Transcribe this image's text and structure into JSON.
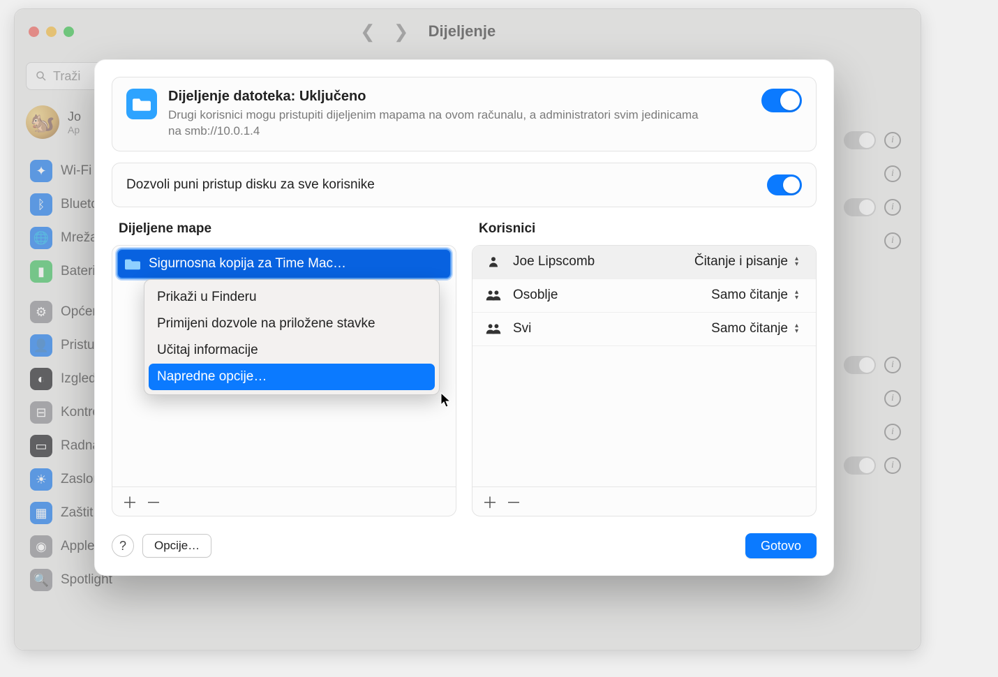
{
  "window": {
    "title": "Dijeljenje",
    "search_placeholder": "Traži"
  },
  "user": {
    "name": "Jo",
    "sub": "Ap"
  },
  "sidebar": {
    "items": [
      {
        "label": "Wi-Fi",
        "color": "#0b7aff"
      },
      {
        "label": "Blueto",
        "color": "#0b7aff"
      },
      {
        "label": "Mreža",
        "color": "#0b7aff"
      },
      {
        "label": "Baterij",
        "color": "#34c759"
      },
      {
        "label": "Općen",
        "color": "#8e8e93"
      },
      {
        "label": "Pristu",
        "color": "#0b7aff"
      },
      {
        "label": "Izgled",
        "color": "#1c1c1e"
      },
      {
        "label": "Kontro",
        "color": "#8e8e93"
      },
      {
        "label": "Radna",
        "color": "#1c1c1e"
      },
      {
        "label": "Zaslon",
        "color": "#0b7aff"
      },
      {
        "label": "Zaštit",
        "color": "#0b7aff"
      },
      {
        "label": "Apple inteligencija i Siri",
        "color": "#8e8e93"
      },
      {
        "label": "Spotlight",
        "color": "#8e8e93"
      }
    ]
  },
  "sheet": {
    "file_sharing_title": "Dijeljenje datoteka: Uključeno",
    "file_sharing_desc": "Drugi korisnici mogu pristupiti dijeljenim mapama na ovom računalu, a administratori svim jedinicama na smb://10.0.1.4",
    "file_sharing_on": true,
    "full_access_label": "Dozvoli puni pristup disku za sve korisnike",
    "full_access_on": true,
    "shared_folders_header": "Dijeljene mape",
    "users_header": "Korisnici",
    "folders": [
      {
        "name": "Sigurnosna kopija za Time Mac…"
      }
    ],
    "users": [
      {
        "name": "Joe Lipscomb",
        "icon": "person",
        "permission": "Čitanje i pisanje"
      },
      {
        "name": "Osoblje",
        "icon": "group",
        "permission": "Samo čitanje"
      },
      {
        "name": "Svi",
        "icon": "group",
        "permission": "Samo čitanje"
      }
    ],
    "context_menu": [
      "Prikaži u Finderu",
      "Primijeni dozvole na priložene stavke",
      "Učitaj informacije",
      "Napredne opcije…"
    ],
    "context_selected": 3,
    "help_label": "?",
    "options_label": "Opcije…",
    "done_label": "Gotovo"
  }
}
